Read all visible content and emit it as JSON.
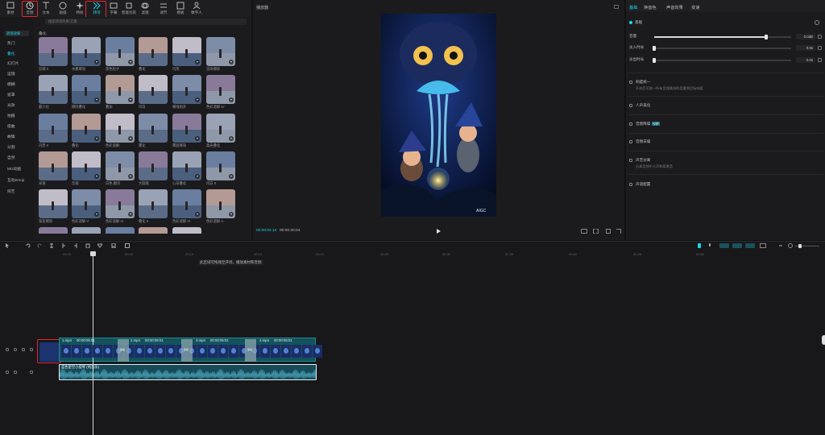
{
  "toolbar": {
    "items": [
      {
        "label": "素材",
        "icon": "media-icon"
      },
      {
        "label": "音频",
        "icon": "audio-icon"
      },
      {
        "label": "文本",
        "icon": "text-icon"
      },
      {
        "label": "贴纸",
        "icon": "sticker-icon"
      },
      {
        "label": "特效",
        "icon": "effects-icon"
      },
      {
        "label": "转场",
        "icon": "transition-icon"
      },
      {
        "label": "字幕",
        "icon": "caption-icon"
      },
      {
        "label": "智能包装",
        "icon": "smart-pack-icon"
      },
      {
        "label": "滤镜",
        "icon": "filter-icon"
      },
      {
        "label": "调节",
        "icon": "adjust-icon"
      },
      {
        "label": "模板",
        "icon": "template-icon"
      },
      {
        "label": "数字人",
        "icon": "avatar-icon"
      }
    ],
    "active": "转场"
  },
  "left": {
    "search_placeholder": "搜索转场效果/元素",
    "filter_chip": "转场效果",
    "section": "叠化",
    "categories": [
      "热门",
      "叠化",
      "幻灯片",
      "运镜",
      "模糊",
      "遮罩",
      "光效",
      "拍摄",
      "扭曲",
      "故障",
      "分割",
      "自然",
      "MG动画",
      "互动emoji",
      "综艺"
    ],
    "active_category": "叠化",
    "items": [
      "云端 II",
      "水墨晕染",
      "黑色粒子",
      "叠化",
      "闪黑",
      "渲染擦除",
      "最小化",
      "擦除叠化",
      "叠加",
      "闪白",
      "横线划开",
      "色彩溶解 IV",
      "闪黑 II",
      "叠化",
      "色彩溶解",
      "雾化",
      "雾面晕染",
      "柔光叠化",
      "光速",
      "云端",
      "白色 翻页",
      "大圆盘",
      "心形叠化",
      "闪白 II",
      "渐变擦除",
      "色彩溶解 V",
      "色彩溶解 III",
      "叠化 II",
      "色彩溶解 VI",
      "色彩溶解 II"
    ]
  },
  "player": {
    "title": "播放器",
    "time_current": "00:00:02:10",
    "time_total": "00:00:20:04",
    "watermark": "AIGC"
  },
  "props": {
    "tabs": [
      "基础",
      "换音色",
      "声音效果",
      "变速"
    ],
    "active_tab": "基础",
    "basic_label": "基础",
    "rows": [
      {
        "label": "音量",
        "value": "0.0dB",
        "level": 0.82
      },
      {
        "label": "淡入时长",
        "value": "0.0s",
        "level": 0.0
      },
      {
        "label": "淡出时长",
        "value": "0.0s",
        "level": 0.0
      }
    ],
    "toggles": [
      {
        "label": "响度统一",
        "desc": "开启后可统一所有音频素材的音量到目标响度"
      },
      {
        "label": "人声美化",
        "desc": ""
      },
      {
        "label": "音频降噪",
        "desc": "",
        "badge": "VIP"
      },
      {
        "label": "音频去噪",
        "desc": ""
      },
      {
        "label": "声音分离",
        "desc": "分离音频中人声和背景音"
      },
      {
        "label": "声道配置",
        "desc": ""
      }
    ]
  },
  "timeline": {
    "ruler": [
      "00:00",
      "00:05",
      "00:10",
      "00:15",
      "00:20",
      "00:25",
      "00:30",
      "00:35",
      "00:40",
      "00:45",
      "00:50"
    ],
    "hint": "此区域可拖拽至开场，播放素材和音频",
    "clips": [
      {
        "name": "1.mp4",
        "duration": "00:00:05:01"
      },
      {
        "name": "2.mp4",
        "duration": "00:00:05:01"
      },
      {
        "name": "3.mp4",
        "duration": "00:00:05:01"
      },
      {
        "name": "4.mp4",
        "duration": "00:00:05:01"
      }
    ],
    "audio_name": "蓝色星空小提琴 (纯音乐)",
    "colors": {
      "accent": "#19d6e8",
      "highlight": "#e3262b",
      "video_track": "#14525c"
    }
  }
}
